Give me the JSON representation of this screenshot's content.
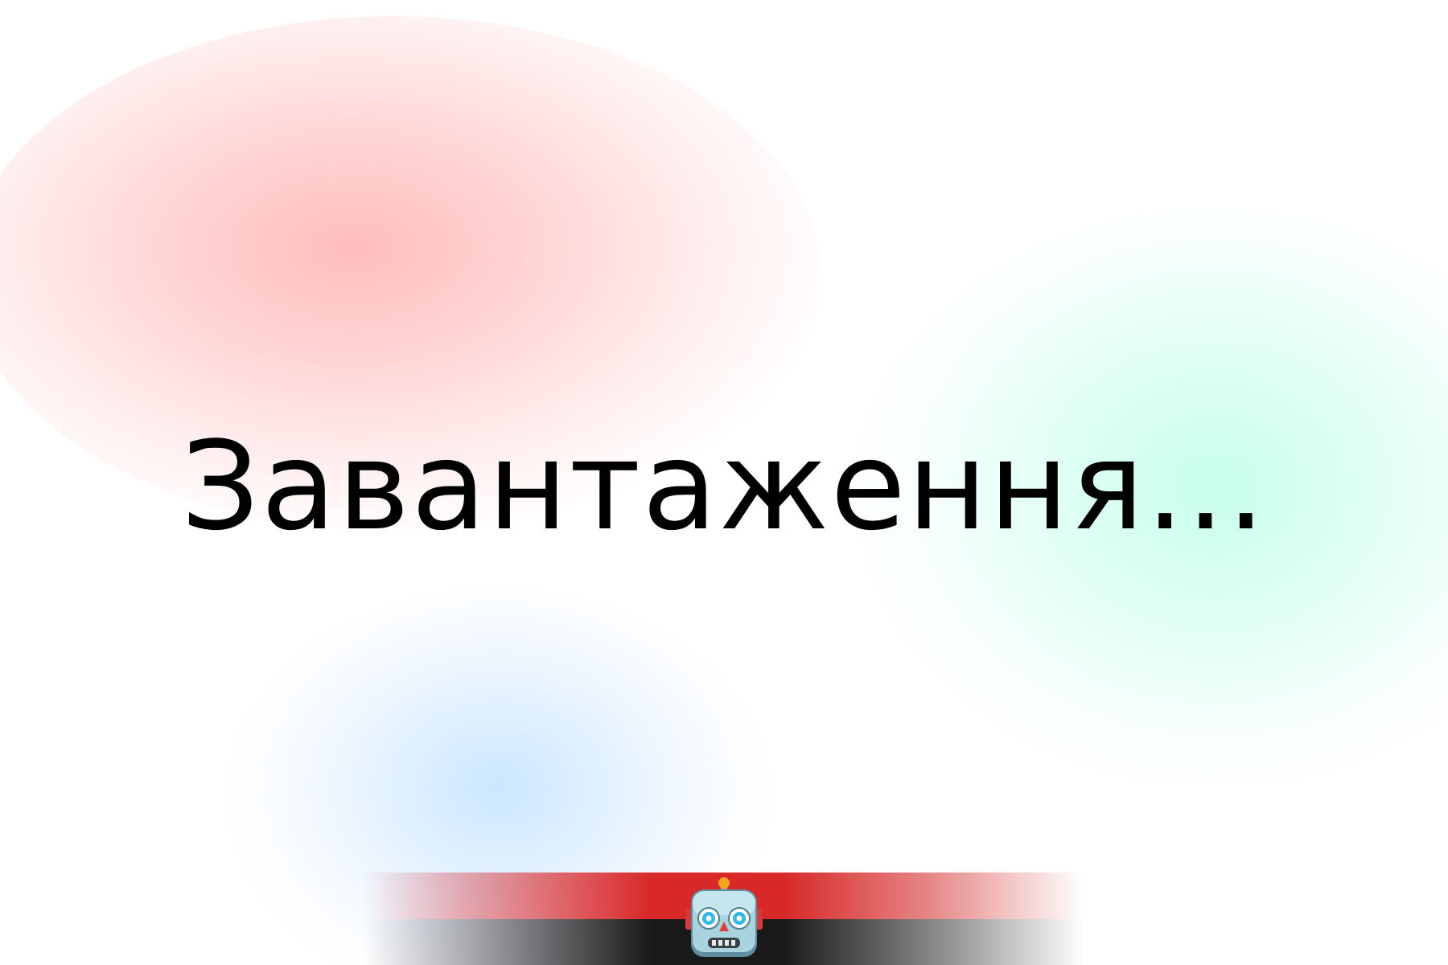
{
  "loading": {
    "text": "Завантаження..."
  },
  "footer": {
    "icon": "robot-icon",
    "colors": {
      "red_band": "#d82828",
      "dark_band": "#191919"
    }
  },
  "background": {
    "colors": {
      "red_glow": "#ffaaaa",
      "mint_glow": "#aaffe1",
      "blue_glow": "#b9deff"
    }
  }
}
